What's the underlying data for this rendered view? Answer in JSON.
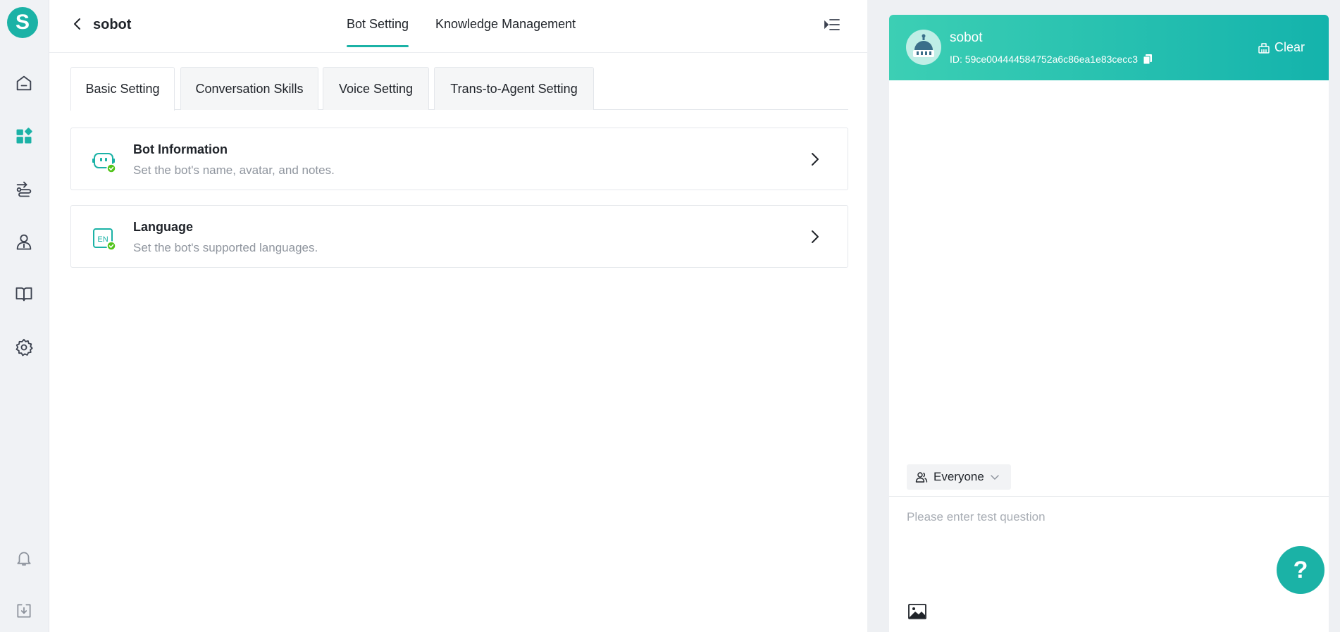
{
  "app": {
    "logo_letter": "S",
    "accent_color": "#1bb2a6",
    "rail_icons": [
      "home-icon",
      "dashboard-icon",
      "flow-icon",
      "user-icon",
      "book-icon",
      "gear-icon",
      "bell-icon",
      "download-icon"
    ]
  },
  "header": {
    "bot_name": "sobot",
    "tabs": [
      {
        "label": "Bot Setting",
        "active": true
      },
      {
        "label": "Knowledge Management",
        "active": false
      }
    ]
  },
  "sub_tabs": [
    {
      "label": "Basic Setting",
      "active": true
    },
    {
      "label": "Conversation Skills",
      "active": false
    },
    {
      "label": "Voice Setting",
      "active": false
    },
    {
      "label": "Trans-to-Agent Setting",
      "active": false
    }
  ],
  "cards": [
    {
      "title": "Bot Information",
      "description": "Set the bot's name, avatar, and notes.",
      "icon": "bot-info-icon"
    },
    {
      "title": "Language",
      "description": "Set the bot's supported languages.",
      "icon": "language-icon",
      "badge": "EN"
    }
  ],
  "chat": {
    "title": "sobot",
    "id_text": "ID: 59ce004444584752a6c86ea1e83cecc3",
    "clear_label": "Clear",
    "audience": "Everyone",
    "input_placeholder": "Please enter test question",
    "help_label": "?"
  }
}
